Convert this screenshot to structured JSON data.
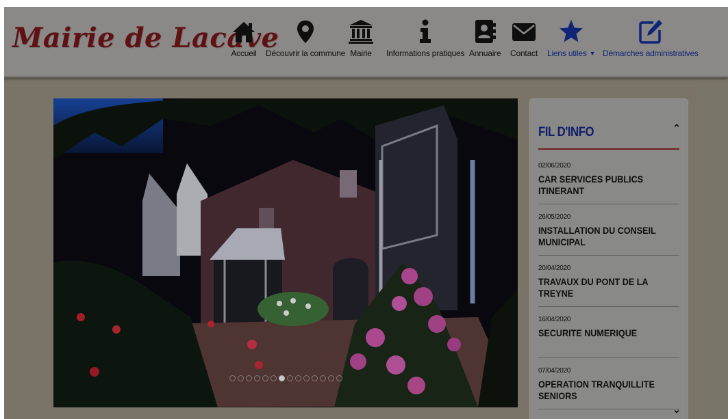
{
  "site": {
    "title": "Mairie de Lacave"
  },
  "nav": {
    "items": [
      {
        "label": "Accueil",
        "icon": "home-icon"
      },
      {
        "label": "Découvrir la commune",
        "icon": "map-marker-icon"
      },
      {
        "label": "Mairie",
        "icon": "town-hall-icon"
      },
      {
        "label": "Informations pratiques",
        "icon": "info-icon"
      },
      {
        "label": "Annuaire",
        "icon": "address-book-icon"
      },
      {
        "label": "Contact",
        "icon": "envelope-icon"
      },
      {
        "label": "Liens utiles",
        "icon": "star-icon",
        "dropdown": true
      },
      {
        "label": "Démarches administratives",
        "icon": "edit-icon"
      }
    ],
    "accent_color": "#122a86"
  },
  "slider": {
    "dot_count": 14,
    "active_index": 6
  },
  "news": {
    "title": "FIL D'INFO",
    "items": [
      {
        "date": "02/06/2020",
        "title": "CAR SERVICES PUBLICS ITINERANT"
      },
      {
        "date": "26/05/2020",
        "title": "INSTALLATION DU CONSEIL MUNICIPAL"
      },
      {
        "date": "20/04/2020",
        "title": "TRAVAUX DU PONT DE LA TREYNE"
      },
      {
        "date": "16/04/2020",
        "title": "SECURITE NUMERIQUE"
      },
      {
        "date": "07/04/2020",
        "title": "OPERATION TRANQUILLITE SENIORS"
      }
    ]
  }
}
